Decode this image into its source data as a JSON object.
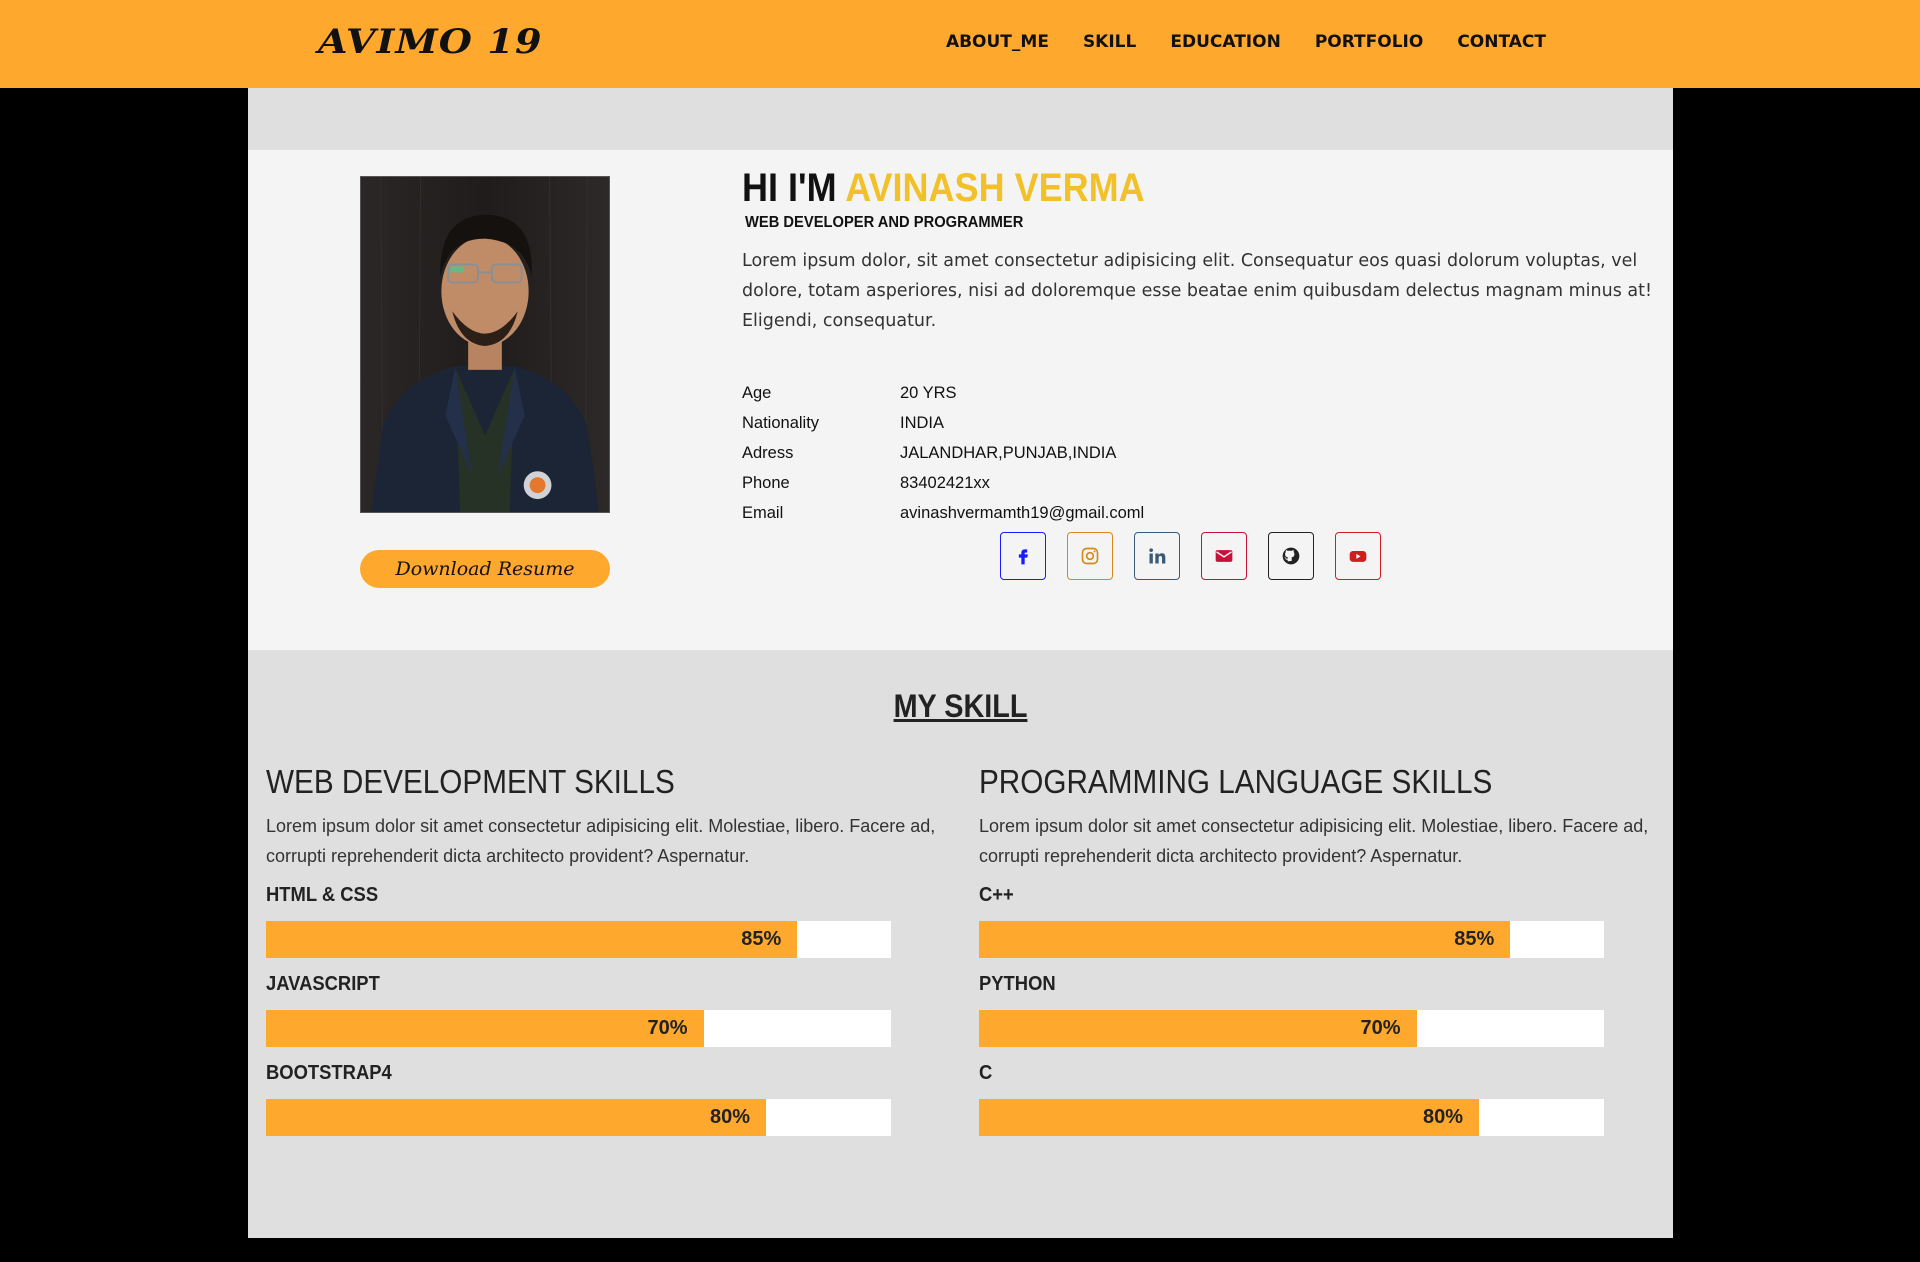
{
  "navbar": {
    "brand": "AVIMO 19",
    "links": [
      "ABOUT_ME",
      "SKILL",
      "EDUCATION",
      "PORTFOLIO",
      "CONTACT"
    ],
    "background": "#ffa82e"
  },
  "profile": {
    "greeting": "HI I'M ",
    "name": "AVINASH VERMA",
    "role": "WEB DEVELOPER AND PROGRAMMER",
    "bio": "Lorem ipsum dolor, sit amet consectetur adipisicing elit. Consequatur eos quasi dolorum voluptas, vel dolore, totam asperiores, nisi ad doloremque esse beatae enim quibusdam delectus magnam minus at! Eligendi, consequatur.",
    "download_label": "Download Resume",
    "photo_icon": "profile-photo",
    "info": [
      {
        "label": "Age",
        "value": "20 YRS"
      },
      {
        "label": "Nationality",
        "value": "INDIA"
      },
      {
        "label": "Adress",
        "value": "JALANDHAR,PUNJAB,INDIA"
      },
      {
        "label": "Phone",
        "value": "83402421xx"
      },
      {
        "label": "Email",
        "value": "avinashvermamth19@gmail.coml"
      }
    ],
    "socials": [
      {
        "icon": "facebook-icon",
        "color": "#1a1aff"
      },
      {
        "icon": "instagram-icon",
        "color": "#d48a1b"
      },
      {
        "icon": "linkedin-icon",
        "color": "#3b5a78"
      },
      {
        "icon": "email-icon",
        "color": "#c8103a"
      },
      {
        "icon": "github-icon",
        "color": "#222222"
      },
      {
        "icon": "youtube-icon",
        "color": "#d01e1e"
      }
    ]
  },
  "skills": {
    "title": "MY SKILL",
    "web": {
      "heading": "WEB DEVELOPMENT SKILLS",
      "desc": "Lorem ipsum dolor sit amet consectetur adipisicing elit. Molestiae, libero. Facere ad, corrupti reprehenderit dicta architecto provident? Aspernatur.",
      "items": [
        {
          "label": "HTML & CSS",
          "percent": 85,
          "text": "85%"
        },
        {
          "label": "JAVASCRIPT",
          "percent": 70,
          "text": "70%"
        },
        {
          "label": "BOOTSTRAP4",
          "percent": 80,
          "text": "80%"
        }
      ]
    },
    "prog": {
      "heading": "PROGRAMMING LANGUAGE SKILLS",
      "desc": "Lorem ipsum dolor sit amet consectetur adipisicing elit. Molestiae, libero. Facere ad, corrupti reprehenderit dicta architecto provident? Aspernatur.",
      "items": [
        {
          "label": "C++",
          "percent": 85,
          "text": "85%"
        },
        {
          "label": "PYTHON",
          "percent": 70,
          "text": "70%"
        },
        {
          "label": "C",
          "percent": 80,
          "text": "80%"
        }
      ]
    },
    "bar_color": "#ffa82e"
  }
}
